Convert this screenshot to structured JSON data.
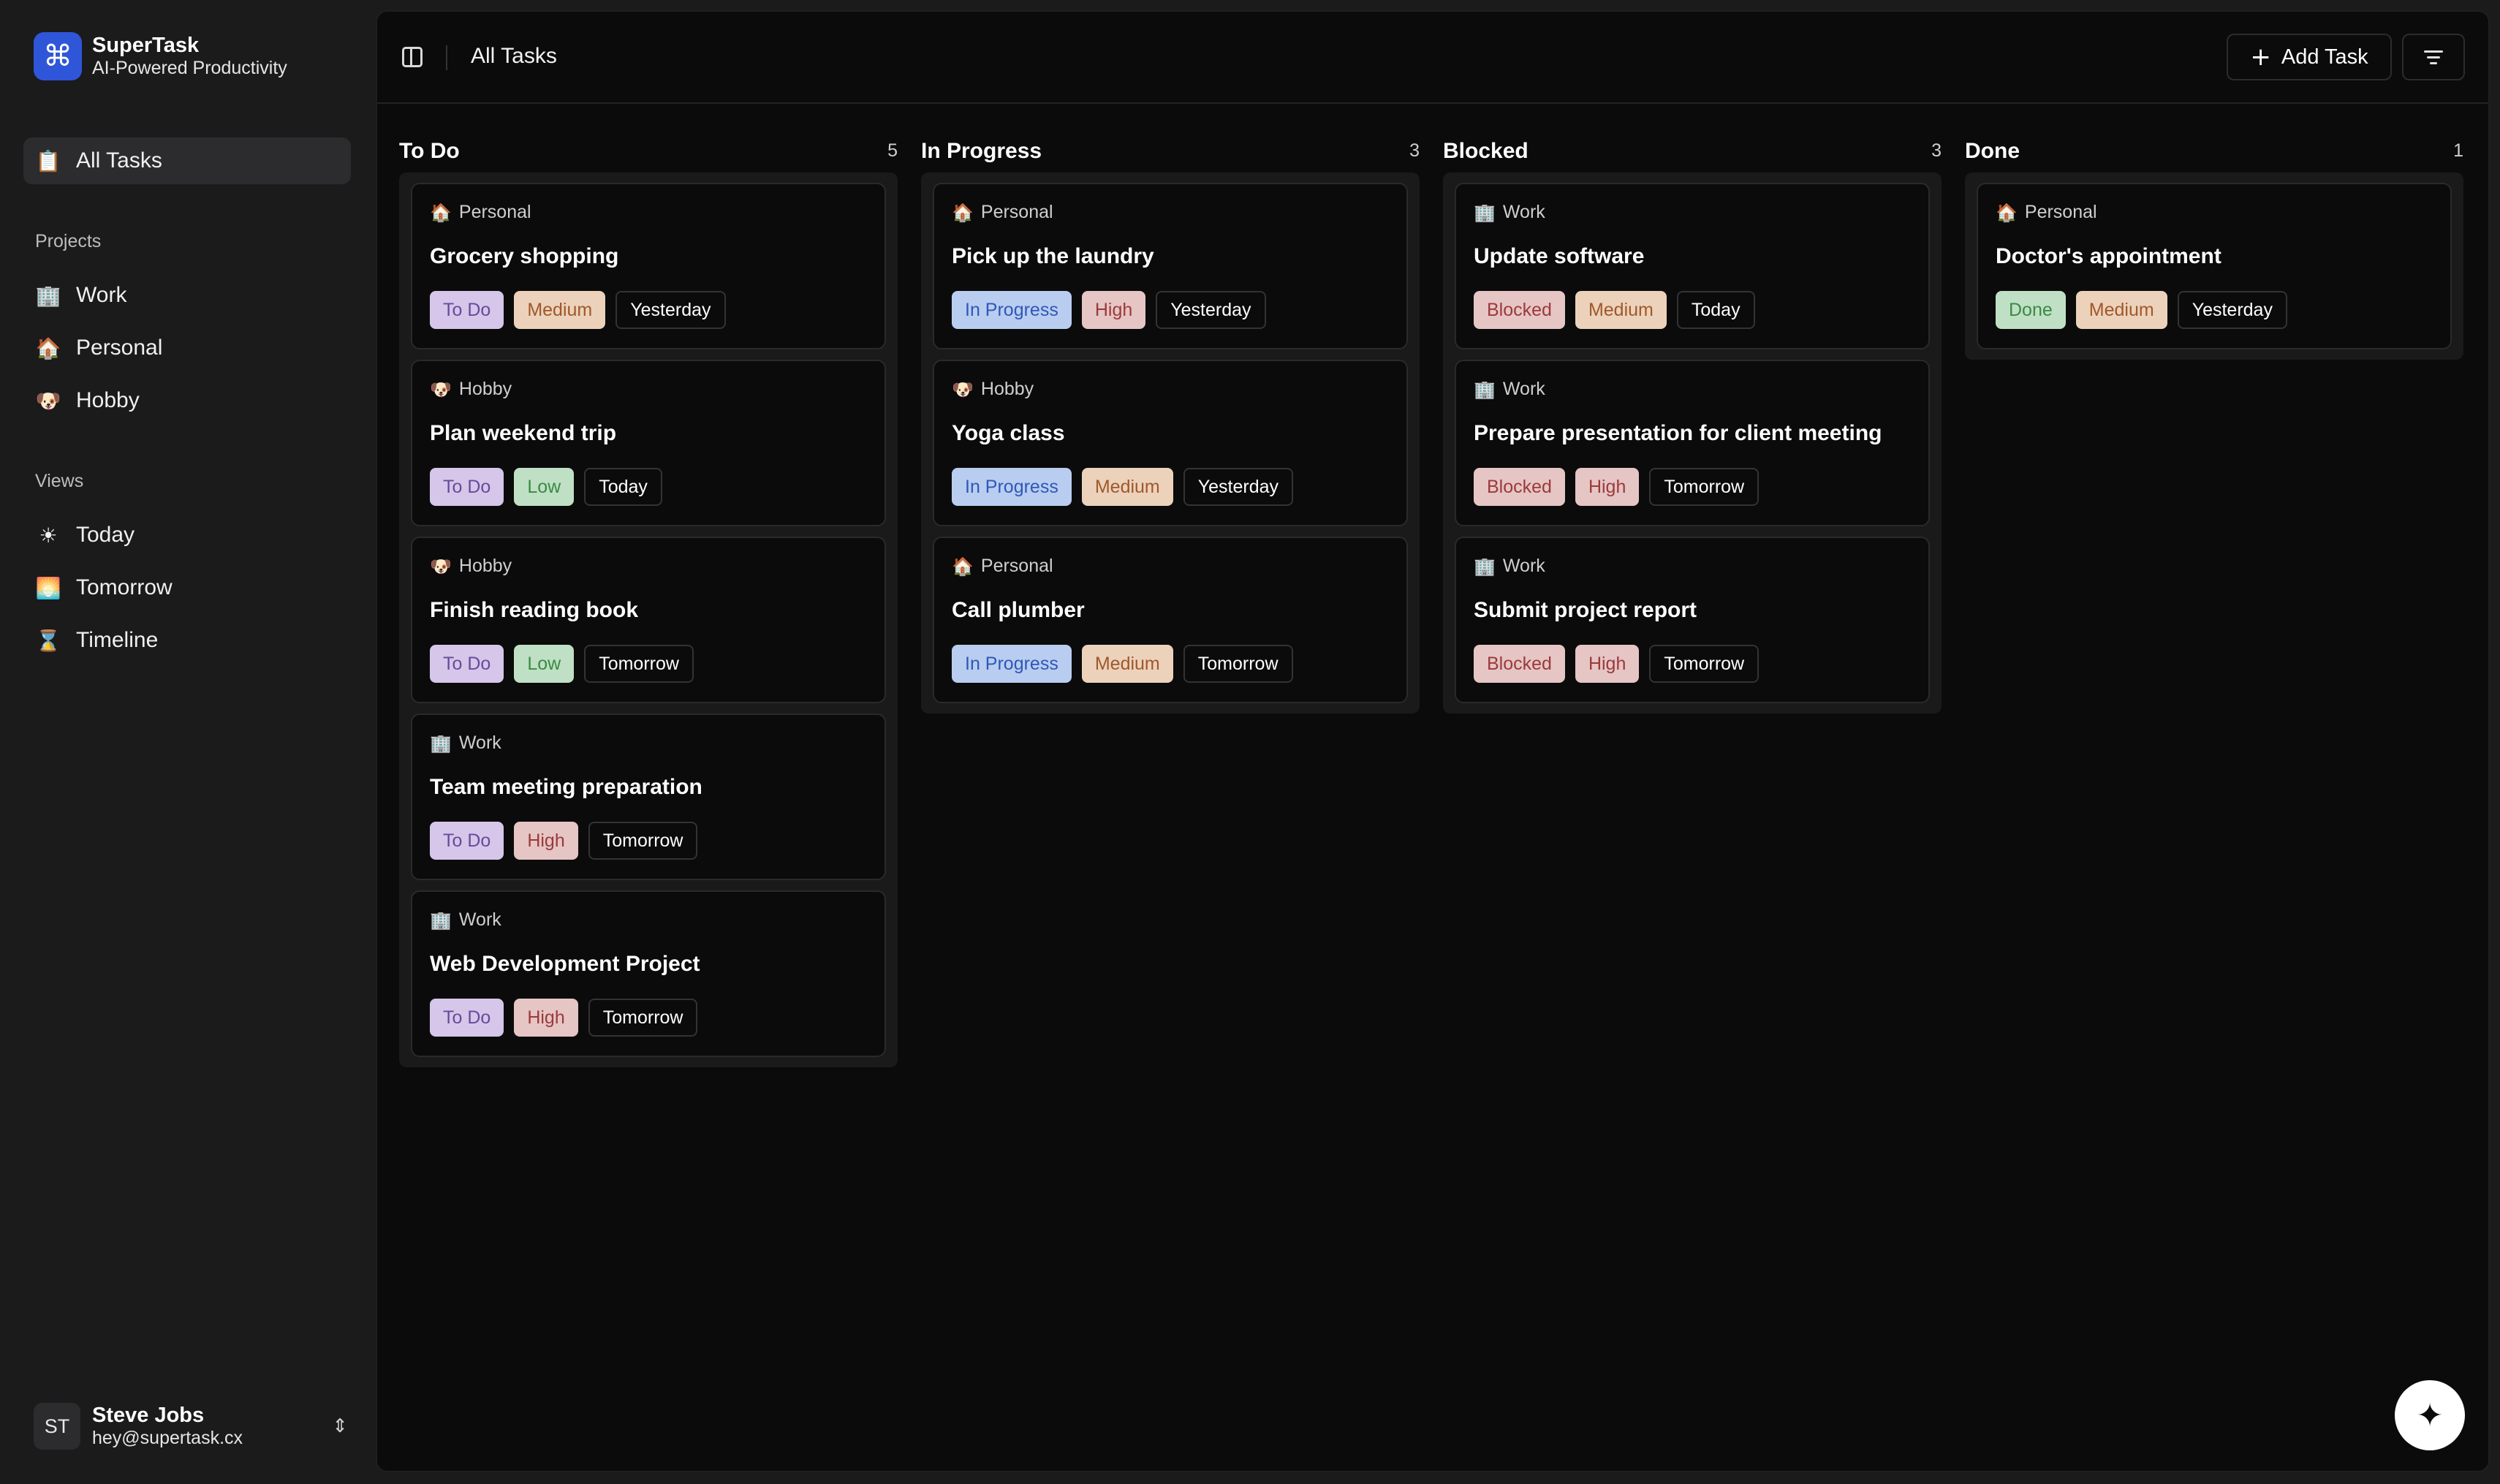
{
  "brand": {
    "name": "SuperTask",
    "subtitle": "AI-Powered Productivity",
    "logo_icon": "command-icon"
  },
  "sidebar": {
    "all_tasks": {
      "label": "All Tasks",
      "icon": "clipboard-icon"
    },
    "projects_label": "Projects",
    "projects": [
      {
        "label": "Work",
        "icon": "office-building-icon"
      },
      {
        "label": "Personal",
        "icon": "house-icon"
      },
      {
        "label": "Hobby",
        "icon": "dog-face-icon"
      }
    ],
    "views_label": "Views",
    "views": [
      {
        "label": "Today",
        "icon": "sun-icon"
      },
      {
        "label": "Tomorrow",
        "icon": "sunrise-icon"
      },
      {
        "label": "Timeline",
        "icon": "hourglass-icon"
      }
    ]
  },
  "user": {
    "initials": "ST",
    "name": "Steve Jobs",
    "email": "hey@supertask.cx"
  },
  "header": {
    "title": "All Tasks",
    "add_task_label": "Add Task"
  },
  "colors": {
    "accent": "#2f56d9",
    "status_todo": "#d6c6ea",
    "status_in_progress": "#b9cdf0",
    "status_blocked": "#e6c5c5",
    "status_done": "#bfe0c4"
  },
  "columns": [
    {
      "title": "To Do",
      "count": "5",
      "cards": [
        {
          "project": "Personal",
          "title": "Grocery shopping",
          "status": "To Do",
          "priority": "Medium",
          "date": "Yesterday"
        },
        {
          "project": "Hobby",
          "title": "Plan weekend trip",
          "status": "To Do",
          "priority": "Low",
          "date": "Today"
        },
        {
          "project": "Hobby",
          "title": "Finish reading book",
          "status": "To Do",
          "priority": "Low",
          "date": "Tomorrow"
        },
        {
          "project": "Work",
          "title": "Team meeting preparation",
          "status": "To Do",
          "priority": "High",
          "date": "Tomorrow"
        },
        {
          "project": "Work",
          "title": "Web Development Project",
          "status": "To Do",
          "priority": "High",
          "date": "Tomorrow"
        }
      ]
    },
    {
      "title": "In Progress",
      "count": "3",
      "cards": [
        {
          "project": "Personal",
          "title": "Pick up the laundry",
          "status": "In Progress",
          "priority": "High",
          "date": "Yesterday"
        },
        {
          "project": "Hobby",
          "title": "Yoga class",
          "status": "In Progress",
          "priority": "Medium",
          "date": "Yesterday"
        },
        {
          "project": "Personal",
          "title": "Call plumber",
          "status": "In Progress",
          "priority": "Medium",
          "date": "Tomorrow"
        }
      ]
    },
    {
      "title": "Blocked",
      "count": "3",
      "cards": [
        {
          "project": "Work",
          "title": "Update software",
          "status": "Blocked",
          "priority": "Medium",
          "date": "Today"
        },
        {
          "project": "Work",
          "title": "Prepare presentation for client meeting",
          "status": "Blocked",
          "priority": "High",
          "date": "Tomorrow"
        },
        {
          "project": "Work",
          "title": "Submit project report",
          "status": "Blocked",
          "priority": "High",
          "date": "Tomorrow"
        }
      ]
    },
    {
      "title": "Done",
      "count": "1",
      "cards": [
        {
          "project": "Personal",
          "title": "Doctor's appointment",
          "status": "Done",
          "priority": "Medium",
          "date": "Yesterday"
        }
      ]
    }
  ]
}
